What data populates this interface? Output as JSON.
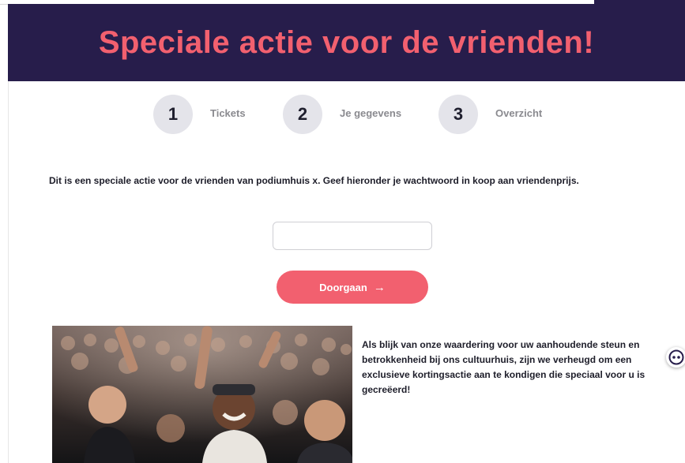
{
  "banner": {
    "title": "Speciale actie voor de vrienden!"
  },
  "steps": [
    {
      "number": "1",
      "label": "Tickets"
    },
    {
      "number": "2",
      "label": "Je gegevens"
    },
    {
      "number": "3",
      "label": "Overzicht"
    }
  ],
  "intro": {
    "text": "Dit is een speciale actie voor de vrienden van podiumhuis x. Geef hieronder je wachtwoord in koop aan vriendenprijs."
  },
  "password": {
    "value": "",
    "placeholder": ""
  },
  "continue": {
    "label": "Doorgaan",
    "arrow": "→"
  },
  "side": {
    "text": "Als blijk van onze waardering voor uw aanhoudende steun en betrokkenheid bij ons cultuurhuis, zijn we verheugd om een exclusieve kortingsactie aan te kondigen die speciaal voor u is gecreëerd!"
  },
  "colors": {
    "banner": "#271d4b",
    "accent": "#f2606f",
    "step_circle": "#e4e4ea"
  },
  "icons": {
    "chat": "chat-bot-icon",
    "photo": "concert-crowd-photo"
  }
}
